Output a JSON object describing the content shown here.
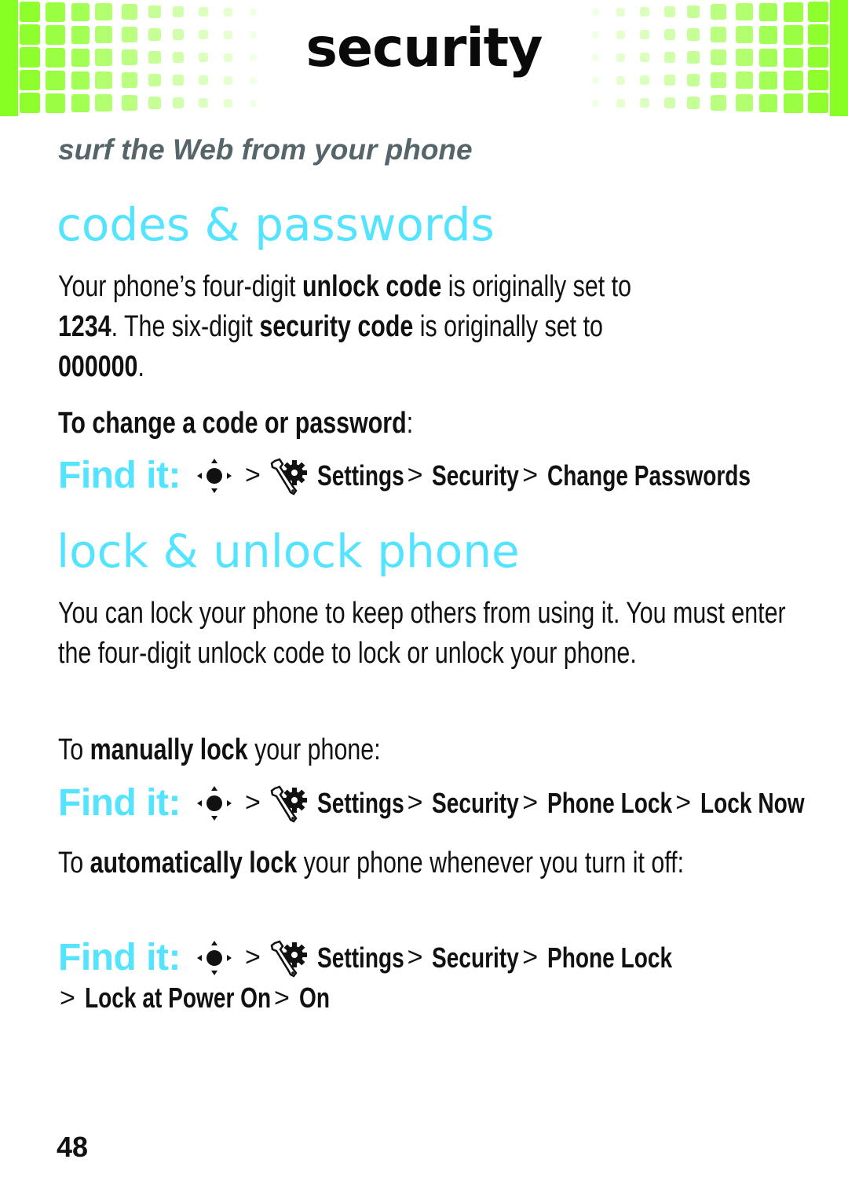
{
  "header": {
    "section_title": "security",
    "accent_color": "#88ff22"
  },
  "subheader": "surf the Web from your phone",
  "sections": [
    {
      "title": "codes & passwords",
      "paragraph": {
        "p1": "Your phone’s four-digit ",
        "b1": "unlock code",
        "p2": " is originally set to ",
        "b2": "1234",
        "p3": ". The six-digit ",
        "b3": "security code",
        "p4": " is originally set to ",
        "b4": "000000",
        "p5": "."
      },
      "instruction": {
        "b1": "To change a code or password",
        "p1": ":"
      },
      "findit": {
        "label": "Find it:",
        "path": [
          "Settings",
          "Security",
          "Change Passwords"
        ]
      }
    },
    {
      "title": "lock & unlock phone",
      "paragraph": "You can lock your phone to keep others from using it. You must enter the four-digit unlock code to lock or unlock your phone.",
      "manual": {
        "p1": "To ",
        "b1": "manually lock",
        "p2": " your phone:"
      },
      "findit_manual": {
        "label": "Find it:",
        "path": [
          "Settings",
          "Security",
          "Phone Lock",
          "Lock Now"
        ]
      },
      "auto": {
        "p1": "To ",
        "b1": "automatically lock",
        "p2": " your phone whenever you turn it off:"
      },
      "findit_auto": {
        "label": "Find it:",
        "path_line1": [
          "Settings",
          "Security",
          "Phone Lock"
        ],
        "path_line2": [
          "Lock at Power On",
          "On"
        ]
      }
    }
  ],
  "separator": ">",
  "icons": {
    "nav_key": "nav-key-icon",
    "settings": "settings-wrench-gear-icon"
  },
  "accent_heading_color": "#55e4ff",
  "page_number": "48"
}
